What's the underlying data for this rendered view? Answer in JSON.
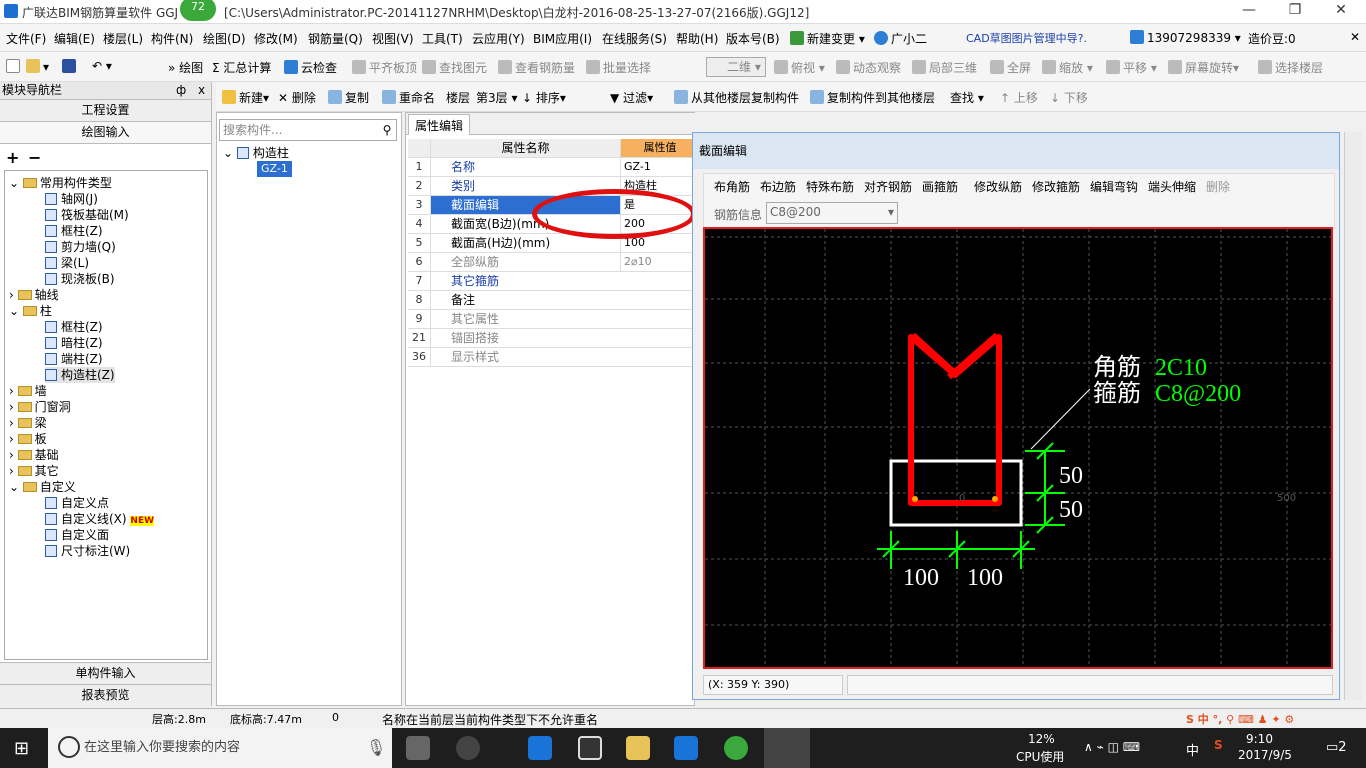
{
  "window": {
    "title": "广联达BIM钢筋算量软件 GGJ",
    "path": "[C:\\Users\\Administrator.PC-20141127NRHM\\Desktop\\白龙村-2016-08-25-13-27-07(2166版).GGJ12]",
    "badge": "72",
    "min": "—",
    "restore": "❐",
    "close": "✕"
  },
  "menu": [
    "文件(F)",
    "编辑(E)",
    "楼层(L)",
    "构件(N)",
    "绘图(D)",
    "修改(M)",
    "钢筋量(Q)",
    "视图(V)",
    "工具(T)",
    "云应用(Y)",
    "BIM应用(I)",
    "在线服务(S)",
    "帮助(H)",
    "版本号(B)",
    "新建变更",
    "广小二",
    "CAD草图图片管理中导?.",
    "13907298339",
    "造价豆:0"
  ],
  "toolbar": {
    "items": [
      "绘图",
      "汇总计算",
      "云检查",
      "平齐板顶",
      "查找图元",
      "查看钢筋量",
      "批量选择",
      "二维",
      "俯视",
      "动态观察",
      "局部三维",
      "全屏",
      "缩放",
      "平移",
      "屏幕旋转",
      "选择楼层"
    ]
  },
  "toolbar2": {
    "items": [
      "新建",
      "删除",
      "复制",
      "重命名",
      "楼层",
      "第3层",
      "排序",
      "过滤",
      "从其他楼层复制构件",
      "复制构件到其他楼层",
      "查找",
      "上移",
      "下移"
    ]
  },
  "nav": {
    "title": "模块导航栏",
    "pin": "ф",
    "close": "x",
    "btns": [
      "工程设置",
      "绘图输入"
    ],
    "add": "+",
    "remove": "−",
    "foot": [
      "单构件输入",
      "报表预览"
    ],
    "tree": [
      "常用构件类型",
      "轴网(J)",
      "筏板基础(M)",
      "框柱(Z)",
      "剪力墙(Q)",
      "梁(L)",
      "现浇板(B)",
      "轴线",
      "柱",
      "框柱(Z)",
      "暗柱(Z)",
      "端柱(Z)",
      "构造柱(Z)",
      "墙",
      "门窗洞",
      "梁",
      "板",
      "基础",
      "其它",
      "自定义",
      "自定义点",
      "自定义线(X)",
      "自定义面",
      "尺寸标注(W)"
    ],
    "new": "NEW"
  },
  "list": {
    "search_ph": "搜索构件...",
    "root": "构造柱",
    "item": "GZ-1"
  },
  "props": {
    "tab": "属性编辑",
    "h_name": "属性名称",
    "h_val": "属性值",
    "rows": [
      [
        "1",
        "名称",
        "GZ-1"
      ],
      [
        "2",
        "类别",
        "构造柱"
      ],
      [
        "3",
        "截面编辑",
        "是"
      ],
      [
        "4",
        "截面宽(B边)(mm)",
        "200"
      ],
      [
        "5",
        "截面高(H边)(mm)",
        "100"
      ],
      [
        "6",
        "全部纵筋",
        "2⌀10"
      ],
      [
        "7",
        "其它箍筋",
        ""
      ],
      [
        "8",
        "备注",
        ""
      ],
      [
        "9",
        "其它属性",
        ""
      ],
      [
        "21",
        "锚固搭接",
        ""
      ],
      [
        "36",
        "显示样式",
        ""
      ]
    ]
  },
  "dialog": {
    "title": "截面编辑",
    "tools": [
      "布角筋",
      "布边筋",
      "特殊布筋",
      "对齐钢筋",
      "画箍筋",
      "修改纵筋",
      "修改箍筋",
      "编辑弯钩",
      "端头伸缩",
      "删除"
    ],
    "info_label": "钢筋信息",
    "info_value": "C8@200",
    "coord": "(X: 359 Y: 390)"
  },
  "canvas": {
    "corner_label": "角筋",
    "corner_val": "2C10",
    "stirrup_label": "箍筋",
    "stirrup_val": "C8@200",
    "dim_h1": "50",
    "dim_h2": "50",
    "dim_w1": "100",
    "dim_w2": "100",
    "zero": "0",
    "tick500": "500"
  },
  "status": {
    "floor_h": "层高:2.8m",
    "bottom_h": "底标高:7.47m",
    "zero": "0",
    "msg": "名称在当前层当前构件类型下不允许重名"
  },
  "taskbar": {
    "search": "在这里输入你要搜索的内容",
    "cpu": "12%",
    "cpu_label": "CPU使用",
    "ime": "中",
    "time": "9:10",
    "date": "2017/9/5",
    "notif": "2"
  }
}
